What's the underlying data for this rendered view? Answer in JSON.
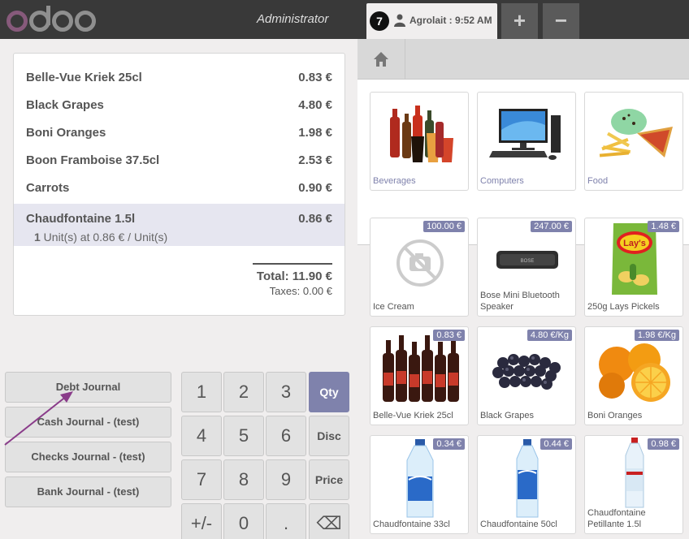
{
  "header": {
    "user_name": "Administrator",
    "order_number": "7",
    "order_label": "Agrolait : 9:52 AM",
    "add_order": "+",
    "remove_order": "−"
  },
  "order": {
    "lines": [
      {
        "name": "Belle-Vue Kriek 25cl",
        "price": "0.83 €"
      },
      {
        "name": "Black Grapes",
        "price": "4.80 €"
      },
      {
        "name": "Boni Oranges",
        "price": "1.98 €"
      },
      {
        "name": "Boon Framboise 37.5cl",
        "price": "2.53 €"
      },
      {
        "name": "Carrots",
        "price": "0.90 €"
      },
      {
        "name": "Chaudfontaine 1.5l",
        "price": "0.86 €",
        "qty": "1",
        "info": " Unit(s) at 0.86 € / Unit(s)"
      }
    ],
    "total": "Total: 11.90 €",
    "taxes": "Taxes: 0.00 €"
  },
  "payment_methods": [
    "Debt Journal",
    "Cash Journal - (test)",
    "Checks Journal - (test)",
    "Bank Journal - (test)"
  ],
  "numpad": {
    "keys": [
      "1",
      "2",
      "3",
      "4",
      "5",
      "6",
      "7",
      "8",
      "9",
      "+/-",
      "0",
      "."
    ],
    "modes": [
      "Qty",
      "Disc",
      "Price"
    ],
    "backspace": "⌫"
  },
  "categories": [
    {
      "name": "Beverages"
    },
    {
      "name": "Computers"
    },
    {
      "name": "Food"
    }
  ],
  "products": [
    {
      "name": "Ice Cream",
      "price": "100.00 €"
    },
    {
      "name": "Bose Mini Bluetooth Speaker",
      "price": "247.00 €"
    },
    {
      "name": "250g Lays Pickels",
      "price": "1.48 €"
    },
    {
      "name": "Belle-Vue Kriek 25cl",
      "price": "0.83 €"
    },
    {
      "name": "Black Grapes",
      "price": "4.80 €/Kg"
    },
    {
      "name": "Boni Oranges",
      "price": "1.98 €/Kg"
    },
    {
      "name": "Chaudfontaine 33cl",
      "price": "0.34 €"
    },
    {
      "name": "Chaudfontaine 50cl",
      "price": "0.44 €"
    },
    {
      "name": "Chaudfontaine Petillante 1.5l",
      "price": "0.98 €"
    }
  ],
  "colors": {
    "accent": "#7f82ac",
    "header": "#393939",
    "logo_purple": "#875a7b"
  }
}
